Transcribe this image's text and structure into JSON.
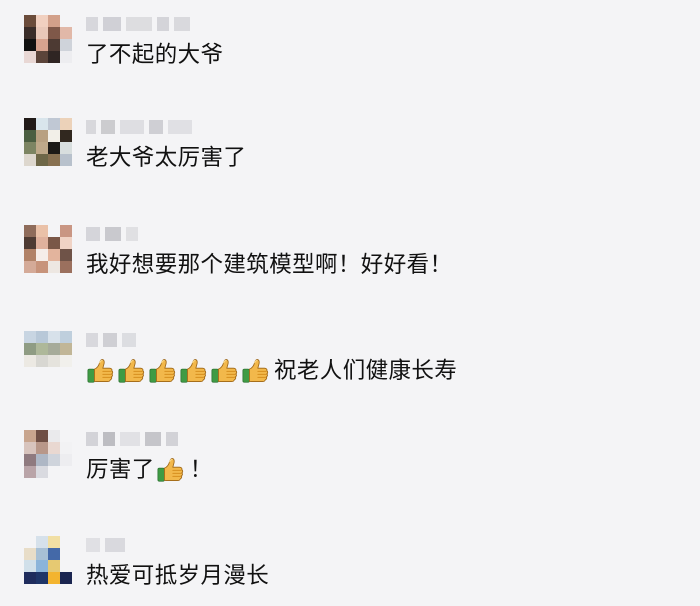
{
  "comments": [
    {
      "text": "了不起的大爷",
      "username_blur": [
        "#d7d7dc",
        "#d0d0d6",
        "#dddde0",
        "#d4d4d9",
        "#d9d9dd"
      ],
      "avatar_palette": [
        "#6b4c3b",
        "#f1d0c0",
        "#d2a08a",
        "#f4f4f6",
        "#3a2d29",
        "#e9c8b9",
        "#7f5849",
        "#e1b8a8",
        "#111111",
        "#d7a38f",
        "#4d3a33",
        "#cfd3da",
        "#e8d7d4",
        "#5b443a",
        "#2f2523",
        "#ededf0"
      ]
    },
    {
      "text": "老大爷太厉害了",
      "username_blur": [
        "#d8d8dc",
        "#cccccf",
        "#dedee2",
        "#cfcfd4",
        "#e0e0e4"
      ],
      "avatar_palette": [
        "#211a18",
        "#d9e5ec",
        "#c0c8d4",
        "#ecd2b9",
        "#4b5e41",
        "#b8a081",
        "#f2efe8",
        "#31281f",
        "#7d8563",
        "#bfa98a",
        "#1c1a17",
        "#d8dede",
        "#ddd7ce",
        "#6e6748",
        "#877051",
        "#b8c1cc"
      ]
    },
    {
      "text": "我好想要那个建筑模型啊！好好看！",
      "username_blur": [
        "#d5d5da",
        "#c9c9ce",
        "#e0e0e3"
      ],
      "avatar_palette": [
        "#8f6c5b",
        "#eac1a8",
        "#f4f4f6",
        "#c99683",
        "#4e3b33",
        "#dfb19d",
        "#7a5747",
        "#f0d3c5",
        "#b18268",
        "#f5ede9",
        "#e3b49d",
        "#6f5348",
        "#d4aa98",
        "#c7937b",
        "#ede7e2",
        "#9b705e"
      ]
    },
    {
      "text": "祝老人们健康长寿",
      "username_blur": [
        "#d8d8dd",
        "#cfcfd4",
        "#dcdde1"
      ],
      "avatar_palette": [
        "#c8d5e2",
        "#b8c8d8",
        "#d7e1ea",
        "#bfcfdd",
        "#8f9c84",
        "#aeb89a",
        "#a6ab9a",
        "#c1b697",
        "#ece9e3",
        "#d8d7d2",
        "#e5e3dd",
        "#f1f0ec",
        "#f4f4f6",
        "#f4f4f6",
        "#f4f4f6",
        "#f4f4f6"
      ],
      "thumbs_count": 6
    },
    {
      "text_before": "厉害了",
      "text_after": "！",
      "username_blur": [
        "#d3d3d8",
        "#bdbdc2",
        "#e1e1e5",
        "#c5c5ca",
        "#d2d2d7"
      ],
      "avatar_palette": [
        "#c8a58e",
        "#6f4f45",
        "#eaeaec",
        "#f4f4f6",
        "#d8c4bd",
        "#b89789",
        "#e9d8d1",
        "#f2f2f4",
        "#8f7a7f",
        "#aeb7c5",
        "#cfd4dc",
        "#ededf0",
        "#b9a4a8",
        "#d9dae0",
        "#f4f4f6",
        "#f4f4f6"
      ]
    },
    {
      "text": "热爱可抵岁月漫长",
      "username_blur": [
        "#e0e0e4",
        "#d9d9de"
      ],
      "avatar_palette": [
        "#f4f4f6",
        "#d6e1eb",
        "#f1dfa4",
        "#f4f4f6",
        "#e8ddc8",
        "#a8c0d5",
        "#4469a8",
        "#f4f4f6",
        "#d1e0ea",
        "#8bb4da",
        "#e6c972",
        "#f4f4f6",
        "#1f2c5d",
        "#1f3568",
        "#f3b42f",
        "#1a2550"
      ]
    }
  ],
  "emoji": {
    "name": "thumbs-up",
    "skin": "#f2b84b",
    "shade": "#d78e1f",
    "sleeve": "#3f9b44",
    "outline": "#9c6414"
  }
}
